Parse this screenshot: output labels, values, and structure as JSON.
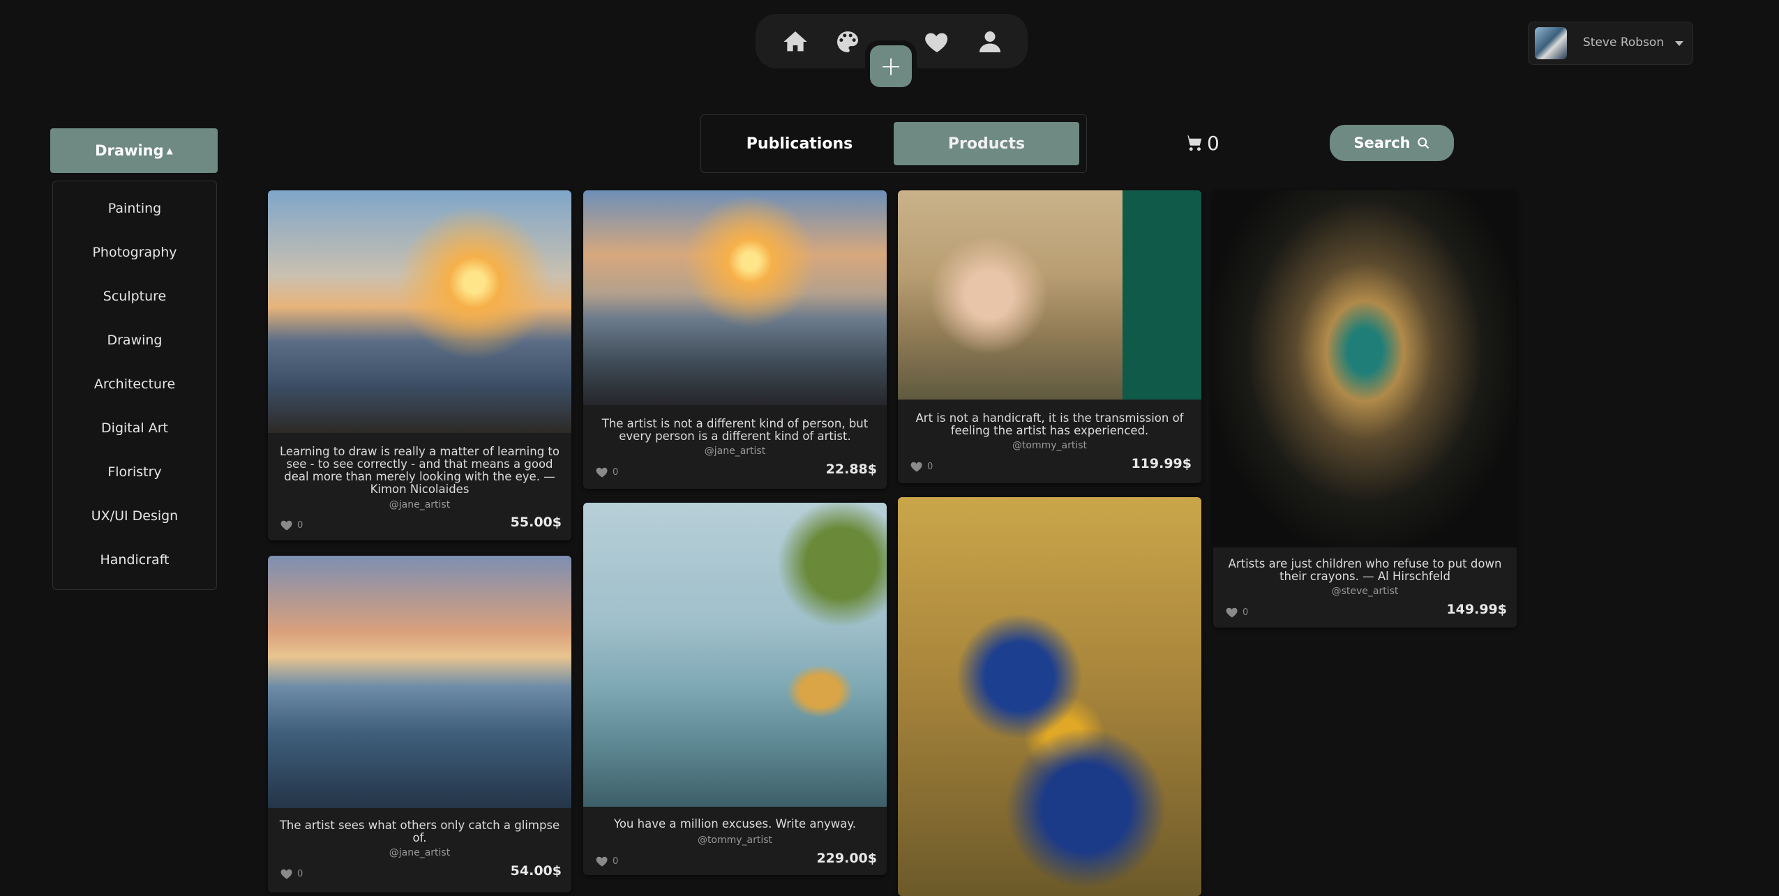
{
  "nav": {
    "icons": [
      "home-icon",
      "palette-icon",
      "heart-icon",
      "user-icon"
    ],
    "add_label": "+"
  },
  "user": {
    "name": "Steve Robson"
  },
  "category": {
    "selected": "Drawing",
    "items": [
      "Painting",
      "Photography",
      "Sculpture",
      "Drawing",
      "Architecture",
      "Digital Art",
      "Floristry",
      "UX/UI Design",
      "Handicraft"
    ]
  },
  "tabs": [
    {
      "label": "Publications",
      "active": false
    },
    {
      "label": "Products",
      "active": true
    }
  ],
  "cart": {
    "count": "0"
  },
  "search": {
    "label": "Search"
  },
  "cards": [
    {
      "quote": "Learning to draw is really a matter of learning to see - to see correctly - and that means a good deal more than merely looking with the eye. — Kimon Nicolaides",
      "author": "@jane_artist",
      "likes": "0",
      "price": "55.00$"
    },
    {
      "quote": "The artist sees what others only catch a glimpse of.",
      "author": "@jane_artist",
      "likes": "0",
      "price": "54.00$"
    },
    {
      "quote": "The artist is not a different kind of person, but every person is a different kind of artist.",
      "author": "@jane_artist",
      "likes": "0",
      "price": "22.88$"
    },
    {
      "quote": "You have a million excuses. Write anyway.",
      "author": "@tommy_artist",
      "likes": "0",
      "price": "229.00$"
    },
    {
      "quote": "Art is not a handicraft, it is the transmission of feeling the artist has experienced.",
      "author": "@tommy_artist",
      "likes": "0",
      "price": "119.99$"
    },
    {
      "quote": "Artists are just children who refuse to put down their crayons. — Al Hirschfeld",
      "author": "@steve_artist",
      "likes": "0",
      "price": "149.99$"
    }
  ],
  "colors": {
    "accent": "#6e8a82",
    "background": "#111111",
    "card": "#1c1c1c"
  }
}
